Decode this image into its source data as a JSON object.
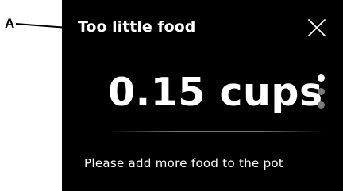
{
  "callout": {
    "label": "A"
  },
  "screen": {
    "title": "Too little food",
    "amount": "0.15 cups",
    "message": "Please add more food to the pot",
    "page_indicator": {
      "total": 3,
      "active_index": 0
    }
  },
  "icons": {
    "close": "close-icon"
  },
  "colors": {
    "screen_background": "#000000",
    "text": "#ffffff",
    "dot_inactive": "#7a7a7a"
  }
}
